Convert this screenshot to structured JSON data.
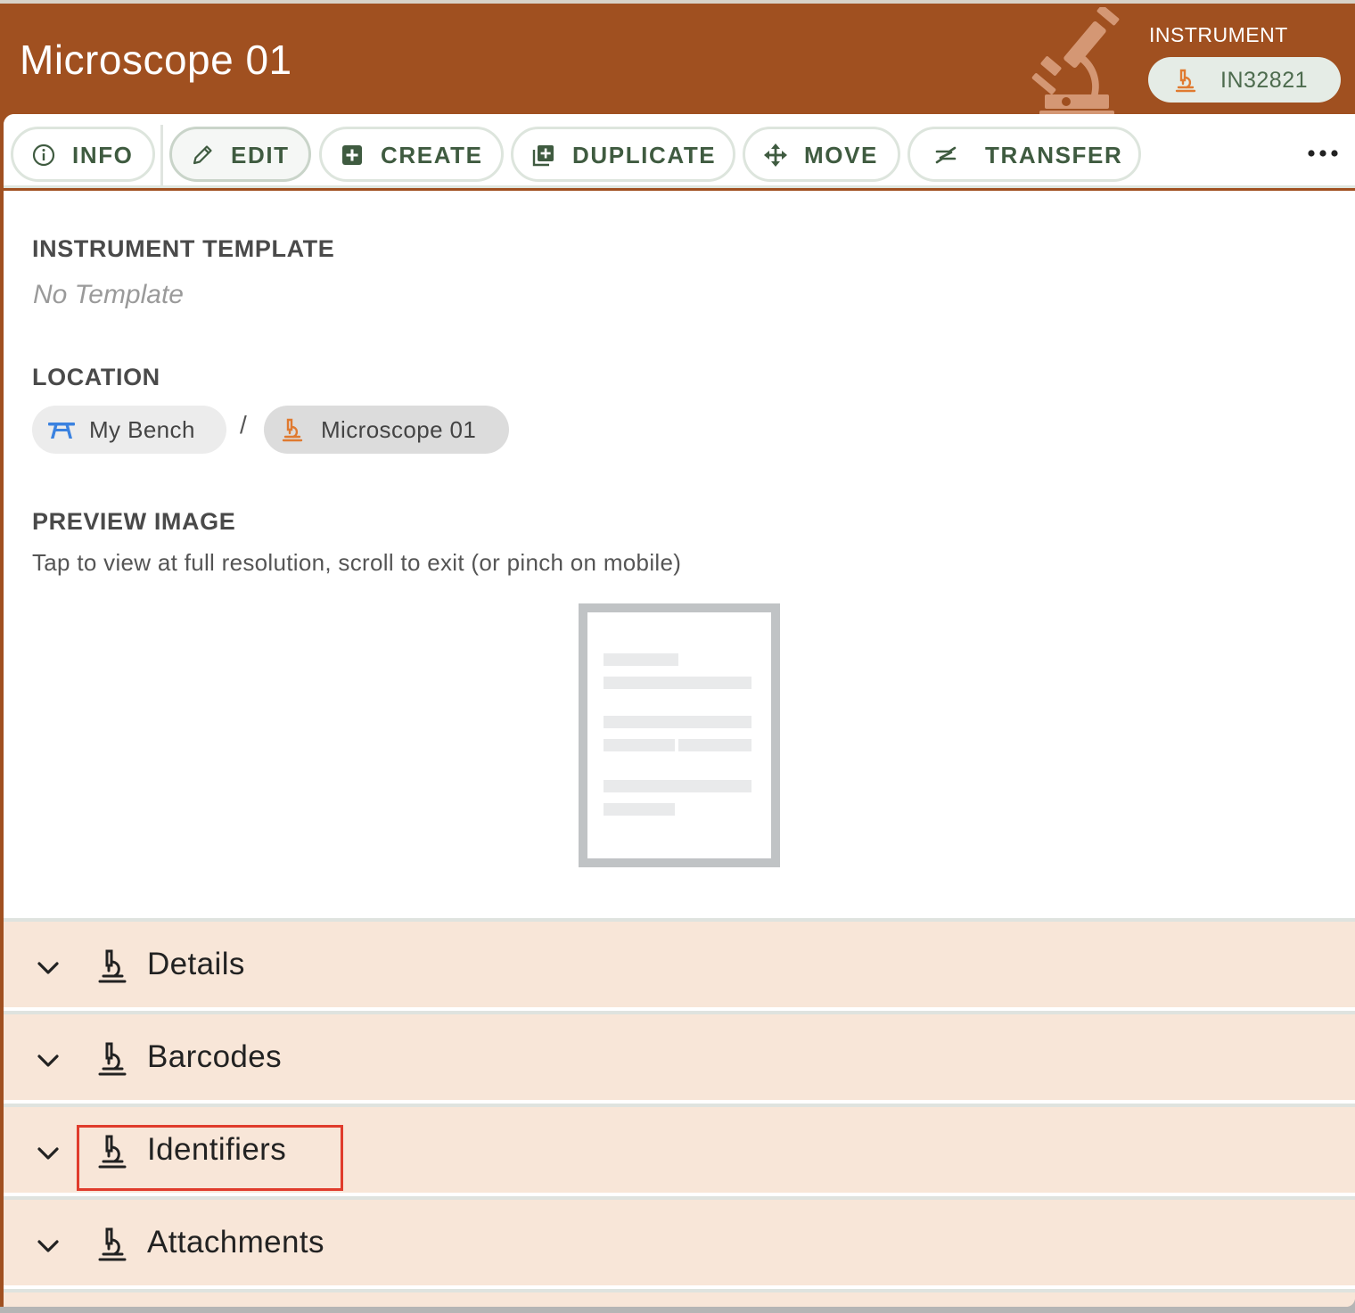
{
  "header": {
    "title": "Microscope 01",
    "type_label": "INSTRUMENT",
    "global_id": "IN32821"
  },
  "toolbar": {
    "info": "INFO",
    "edit": "EDIT",
    "create": "CREATE",
    "duplicate": "DUPLICATE",
    "move": "MOVE",
    "transfer": "TRANSFER"
  },
  "template_section": {
    "title": "INSTRUMENT TEMPLATE",
    "value": "No Template"
  },
  "location_section": {
    "title": "LOCATION",
    "path": [
      "My Bench",
      "Microscope 01"
    ],
    "separator": "/"
  },
  "preview_section": {
    "title": "PREVIEW IMAGE",
    "hint": "Tap to view at full resolution, scroll to exit (or pinch on mobile)"
  },
  "accordion": {
    "items": [
      "Details",
      "Barcodes",
      "Identifiers",
      "Attachments"
    ]
  },
  "colors": {
    "header_bg": "#a05020",
    "toolbar_text": "#3f5b40",
    "accordion_bg": "#f8e6d8",
    "highlight_border": "#e03c2c",
    "bench_icon": "#3b82e0",
    "instrument_icon": "#e07a30"
  },
  "icons": {
    "header": "microscope-icon",
    "info": "info-circle-icon",
    "edit": "pencil-icon",
    "create": "plus-square-icon",
    "duplicate": "duplicate-icon",
    "move": "move-arrows-icon",
    "transfer": "transfer-hands-icon",
    "more": "ellipsis-icon",
    "bench": "bench-icon",
    "accordion_chevron": "chevron-down-icon"
  }
}
